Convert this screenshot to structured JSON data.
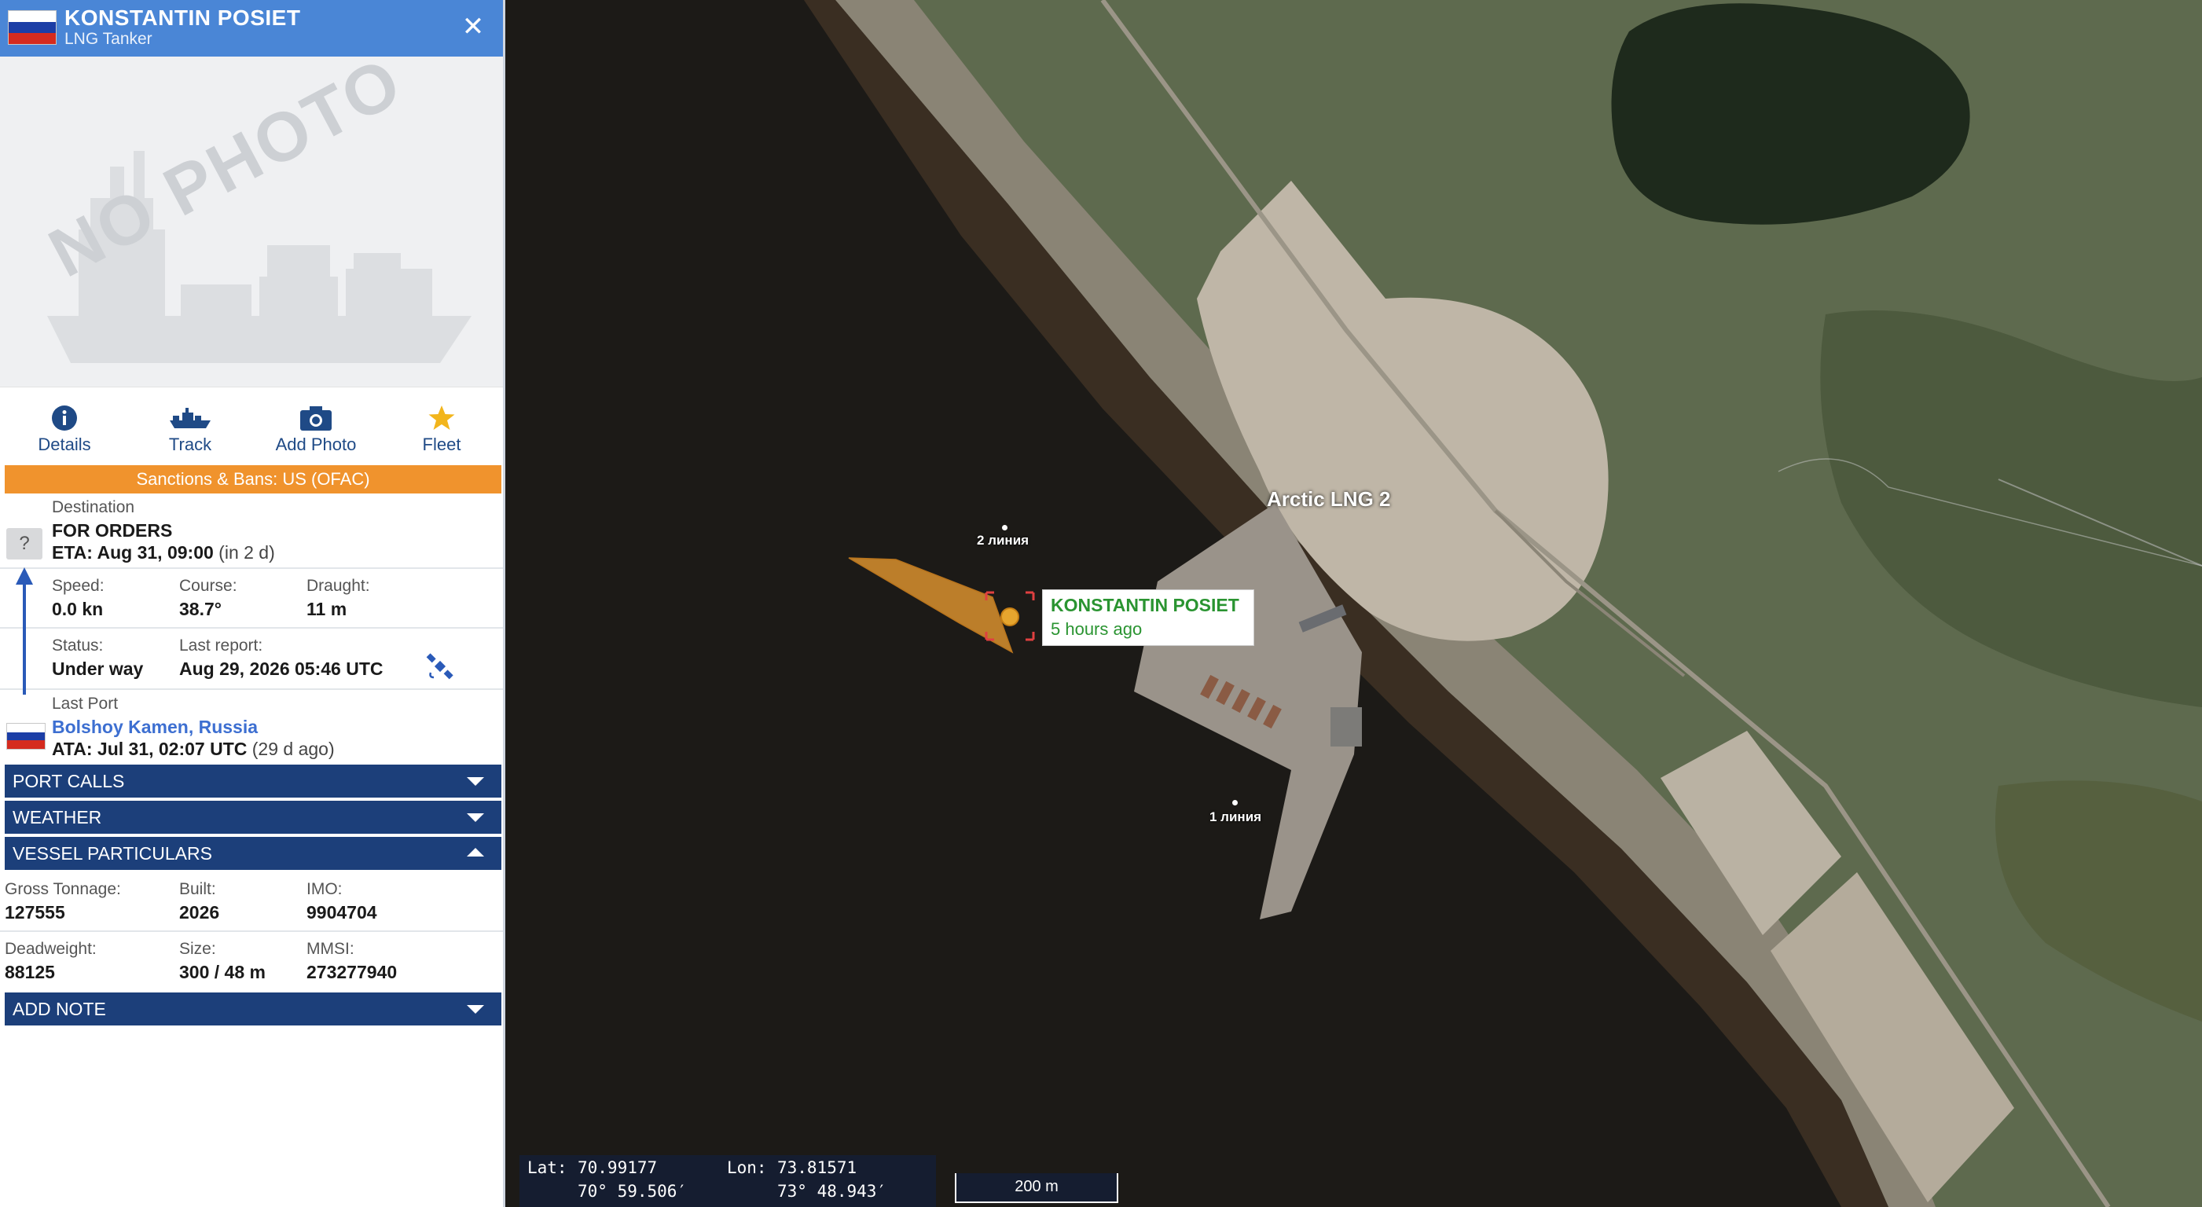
{
  "vessel": {
    "name": "KONSTANTIN POSIET",
    "type": "LNG Tanker",
    "flag": "russia-flag",
    "no_photo_text": "NO PHOTO"
  },
  "actions": [
    {
      "label": "Details",
      "icon": "info-icon"
    },
    {
      "label": "Track",
      "icon": "ship-track-icon"
    },
    {
      "label": "Add Photo",
      "icon": "camera-icon"
    },
    {
      "label": "Fleet",
      "icon": "star-icon"
    }
  ],
  "sanctions": "Sanctions & Bans: US (OFAC)",
  "destination": {
    "label": "Destination",
    "value": "FOR ORDERS",
    "eta": "ETA: Aug 31, 09:00",
    "eta_note": "(in 2 d)",
    "unknown_icon": "?"
  },
  "voyage": {
    "speed_label": "Speed:",
    "speed": "0.0 kn",
    "course_label": "Course:",
    "course": "38.7°",
    "draught_label": "Draught:",
    "draught": "11 m",
    "status_label": "Status:",
    "status": "Under way",
    "last_report_label": "Last report:",
    "last_report": "Aug 29, 2026 05:46 UTC"
  },
  "last_port": {
    "label": "Last Port",
    "name": "Bolshoy Kamen, Russia",
    "ata": "ATA: Jul 31, 02:07 UTC",
    "ata_note": "(29 d ago)"
  },
  "accordions": {
    "port_calls": "PORT CALLS",
    "weather": "WEATHER",
    "vessel_particulars": "VESSEL PARTICULARS",
    "add_note": "ADD NOTE"
  },
  "particulars": {
    "gt_label": "Gross Tonnage:",
    "gt": "127555",
    "built_label": "Built:",
    "built": "2026",
    "imo_label": "IMO:",
    "imo": "9904704",
    "dwt_label": "Deadweight:",
    "dwt": "88125",
    "size_label": "Size:",
    "size": "300 / 48 m",
    "mmsi_label": "MMSI:",
    "mmsi": "273277940"
  },
  "map": {
    "place_label": "Arctic LNG 2",
    "line2_label": "2 линия",
    "line1_label": "1 линия",
    "tooltip_name": "KONSTANTIN POSIET",
    "tooltip_time": "5 hours ago",
    "lat_label": "Lat:",
    "lat_dec": "70.99177",
    "lat_dms": "70° 59.506′",
    "lon_label": "Lon:",
    "lon_dec": "73.81571",
    "lon_dms": "73° 48.943′",
    "scale": "200 m"
  },
  "colors": {
    "header": "#4a86d6",
    "accordion": "#1c3f7a",
    "sanctions": "#f0932d",
    "vessel_marker": "#d8902e",
    "tooltip_text": "#2a9431"
  }
}
